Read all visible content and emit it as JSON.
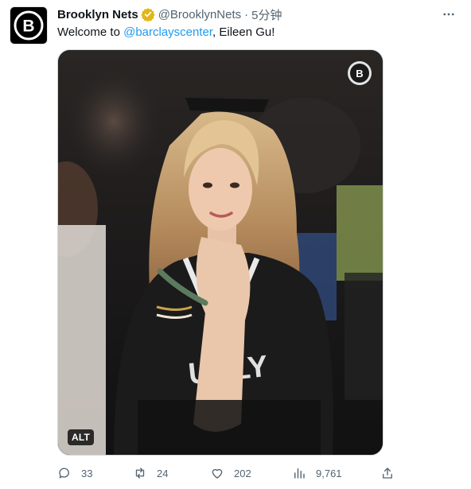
{
  "tweet": {
    "display_name": "Brooklyn Nets",
    "handle": "@BrooklynNets",
    "separator": "·",
    "time": "5分钟",
    "text_before": "Welcome to ",
    "mention": "@barclayscenter",
    "text_after": ", Eileen Gu!",
    "alt_badge": "ALT",
    "avatar_letter": "B",
    "watermark_letter": "B"
  },
  "actions": {
    "replies": "33",
    "retweets": "24",
    "likes": "202",
    "views": "9,761"
  },
  "colors": {
    "link": "#1d9bf0",
    "secondary_text": "#536471",
    "verified_badge": "#e2b719"
  },
  "icons": [
    "more-icon",
    "verified-badge-icon",
    "reply-icon",
    "retweet-icon",
    "like-icon",
    "views-icon",
    "share-icon"
  ]
}
